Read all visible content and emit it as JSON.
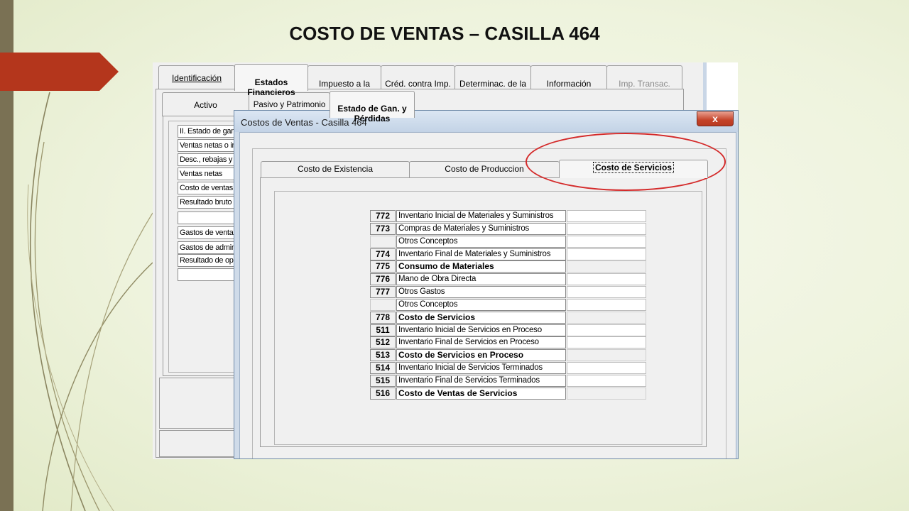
{
  "slide": {
    "title": "COSTO DE VENTAS – CASILLA 464",
    "accent_color": "#b4361c",
    "highlight_color": "#d42a2a"
  },
  "main_window": {
    "top_tabs": [
      {
        "label": "Identificación"
      },
      {
        "label": "Estados\nFinancieros",
        "selected": true
      },
      {
        "label": "Impuesto a la\nRenta"
      },
      {
        "label": "Créd. contra Imp.\nRenta"
      },
      {
        "label": "Determinac. de la\nDeuda"
      },
      {
        "label": "Información\nComplement."
      },
      {
        "label": "Imp. Transac.\nFinancieras",
        "disabled": true
      }
    ],
    "sub_tabs": [
      {
        "label": "Activo"
      },
      {
        "label": "Pasivo y Patrimonio"
      },
      {
        "label": "Estado de Gan. y\nPérdidas",
        "selected": true
      }
    ],
    "rows": [
      "II. Estado de ganancias",
      "Ventas netas o ingresos",
      "Desc., rebajas y bonificaciones",
      "Ventas netas",
      "Costo de ventas",
      "Resultado bruto",
      "",
      "Gastos de ventas",
      "Gastos de administración",
      "Resultado de operación",
      ""
    ]
  },
  "dialog": {
    "title": "Costos de Ventas - Casilla 464",
    "close_label": "x",
    "tabs": [
      {
        "label": "Costo de Existencia"
      },
      {
        "label": "Costo de Produccion"
      },
      {
        "label": "Costo de Servicios",
        "selected": true
      }
    ],
    "rows": [
      {
        "code": "772",
        "label": "Inventario Inicial de Materiales y Suministros",
        "bold": false
      },
      {
        "code": "773",
        "label": "Compras de Materiales y Suministros",
        "bold": false
      },
      {
        "code": "",
        "label": "Otros Conceptos",
        "bold": false
      },
      {
        "code": "774",
        "label": "Inventario Final de Materiales y Suministros",
        "bold": false
      },
      {
        "code": "775",
        "label": "Consumo de Materiales",
        "bold": true
      },
      {
        "code": "776",
        "label": "Mano de Obra Directa",
        "bold": false
      },
      {
        "code": "777",
        "label": "Otros Gastos",
        "bold": false
      },
      {
        "code": "",
        "label": "Otros Conceptos",
        "bold": false
      },
      {
        "code": "778",
        "label": "Costo de Servicios",
        "bold": true
      },
      {
        "code": "511",
        "label": "Inventario Inicial de Servicios en Proceso",
        "bold": false
      },
      {
        "code": "512",
        "label": "Inventario Final de Servicios en Proceso",
        "bold": false
      },
      {
        "code": "513",
        "label": "Costo de Servicios en Proceso",
        "bold": true
      },
      {
        "code": "514",
        "label": "Inventario Inicial de Servicios Terminados",
        "bold": false
      },
      {
        "code": "515",
        "label": "Inventario Final de Servicios Terminados",
        "bold": false
      },
      {
        "code": "516",
        "label": "Costo de Ventas de Servicios",
        "bold": true
      }
    ]
  }
}
